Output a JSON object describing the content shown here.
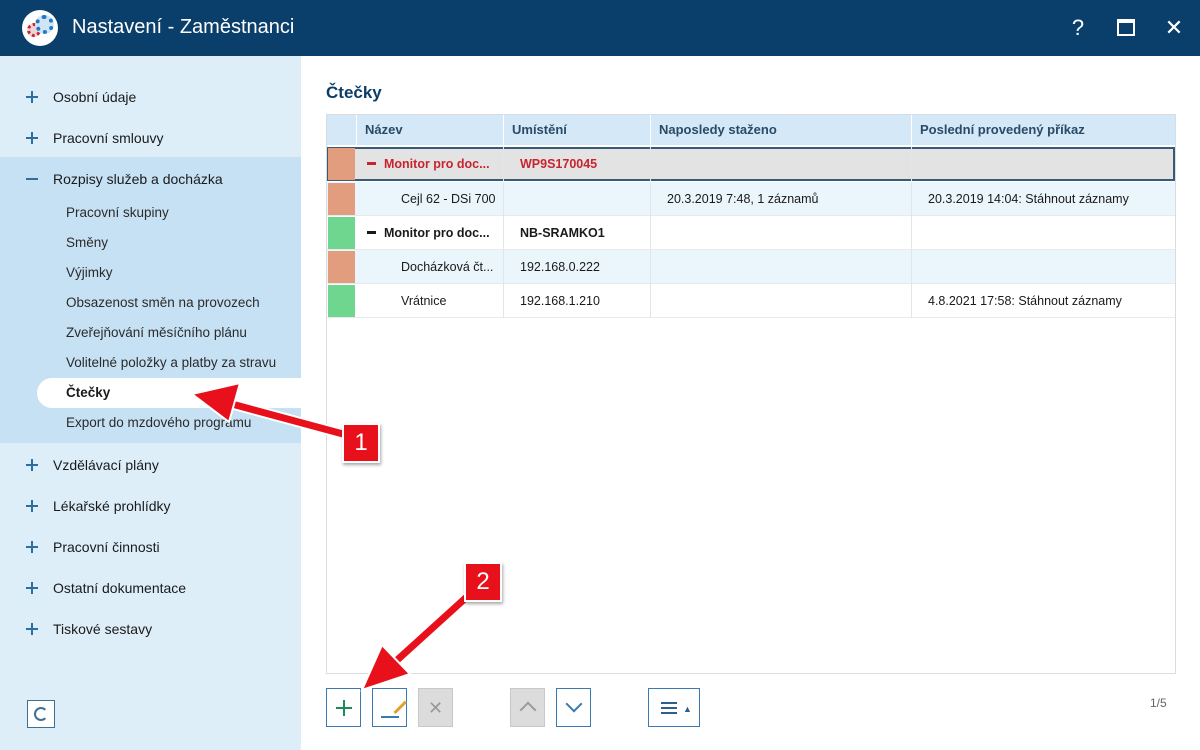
{
  "window": {
    "title": "Nastavení - Zaměstnanci",
    "help_label": "?",
    "close_label": "✕"
  },
  "sidebar": {
    "groups": [
      {
        "label": "Osobní údaje",
        "expanded": false
      },
      {
        "label": "Pracovní smlouvy",
        "expanded": false
      },
      {
        "label": "Rozpisy služeb a docházka",
        "expanded": true
      },
      {
        "label": "Vzdělávací plány",
        "expanded": false
      },
      {
        "label": "Lékařské prohlídky",
        "expanded": false
      },
      {
        "label": "Pracovní činnosti",
        "expanded": false
      },
      {
        "label": "Ostatní dokumentace",
        "expanded": false
      },
      {
        "label": "Tiskové sestavy",
        "expanded": false
      }
    ],
    "subitems": [
      "Pracovní skupiny",
      "Směny",
      "Výjimky",
      "Obsazenost směn na provozech",
      "Zveřejňování měsíčního plánu",
      "Volitelné položky a platby za stravu",
      "Čtečky",
      "Export do mzdového programu"
    ],
    "active_subitem": "Čtečky"
  },
  "main": {
    "title": "Čtečky",
    "columns": [
      "Název",
      "Umístění",
      "Naposledy staženo",
      "Poslední provedený příkaz"
    ],
    "rows": [
      {
        "status_color": "#e29d7e",
        "name": "Monitor pro doc...",
        "location": "WP9S170045",
        "last_download": "",
        "last_command": "",
        "kind": "group",
        "selected": true
      },
      {
        "status_color": "#e29d7e",
        "name": "Cejl 62 - DSi 700",
        "location": "",
        "last_download": "20.3.2019 7:48, 1 záznamů",
        "last_command": "20.3.2019 14:04: Stáhnout záznamy",
        "kind": "child"
      },
      {
        "status_color": "#6fd68f",
        "name": "Monitor pro doc...",
        "location": "NB-SRAMKO1",
        "last_download": "",
        "last_command": "",
        "kind": "group"
      },
      {
        "status_color": "#e29d7e",
        "name": "Docházková čt...",
        "location": "192.168.0.222",
        "last_download": "",
        "last_command": "",
        "kind": "child"
      },
      {
        "status_color": "#6fd68f",
        "name": "Vrátnice",
        "location": "192.168.1.210",
        "last_download": "",
        "last_command": "4.8.2021 17:58: Stáhnout záznamy",
        "kind": "child"
      }
    ],
    "pager": "1/5"
  },
  "annotations": {
    "callout_1": "1",
    "callout_2": "2"
  },
  "colors": {
    "titlebar": "#0b3f6b",
    "sidebar": "#ddeef9",
    "sidebar_expanded": "#c6e1f4",
    "accent": "#3a7ab0",
    "annotation_red": "#e8101a"
  }
}
